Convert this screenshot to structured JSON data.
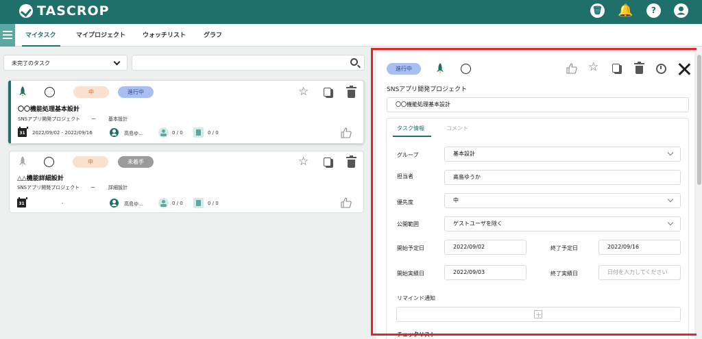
{
  "app": {
    "logo_text": "TASCROP"
  },
  "header_icons": [
    "trash-icon",
    "bell-icon",
    "help-icon",
    "user-icon"
  ],
  "nav": {
    "tabs": [
      {
        "label": "マイタスク",
        "active": true
      },
      {
        "label": "マイプロジェクト"
      },
      {
        "label": "ウォッチリスト"
      },
      {
        "label": "グラフ"
      }
    ]
  },
  "filter": {
    "selected": "未完了のタスク",
    "search_value": ""
  },
  "tasks": [
    {
      "priority": "中",
      "status": "進行中",
      "title": "〇〇機能処理基本設計",
      "project": "SNSアプリ開発プロジェクト",
      "sep": "ー",
      "phase": "基本設計",
      "date_range": "2022/09/02 - 2022/09/16",
      "assignee": "高島ゆ…",
      "sub_count": "0 / 0",
      "check_count": "0 / 0"
    },
    {
      "priority": "中",
      "status": "未着手",
      "title": "△△機能詳細設計",
      "project": "SNSアプリ開発プロジェクト",
      "sep": "ー",
      "phase": "詳細設計",
      "date_range": "-",
      "assignee": "高島ゆ…",
      "sub_count": "0 / 0",
      "check_count": "0 / 0"
    }
  ],
  "detail": {
    "status": "進行中",
    "project": "SNSアプリ開発プロジェクト",
    "task_name": "〇〇機能処理基本設計",
    "tabs": {
      "info": "タスク情報",
      "comment": "コメント"
    },
    "group_label": "グループ",
    "group_value": "基本設計",
    "assignee_label": "担当者",
    "assignee_value": "高島ゆうか",
    "priority_label": "優先度",
    "priority_value": "中",
    "visibility_label": "公開範囲",
    "visibility_value": "ゲストユーザを除く",
    "start_plan_label": "開始予定日",
    "start_plan_value": "2022/09/02",
    "end_plan_label": "終了予定日",
    "end_plan_value": "2022/09/16",
    "start_actual_label": "開始実績日",
    "start_actual_value": "2022/09/03",
    "end_actual_label": "終了実績日",
    "end_actual_placeholder": "日付を入力してください",
    "remind_label": "リマインド通知",
    "checklist_label": "チェックリスト"
  },
  "colors": {
    "header": "#1f6f6a",
    "accent": "#1f6f6a",
    "highlight_border": "#e3262b"
  }
}
